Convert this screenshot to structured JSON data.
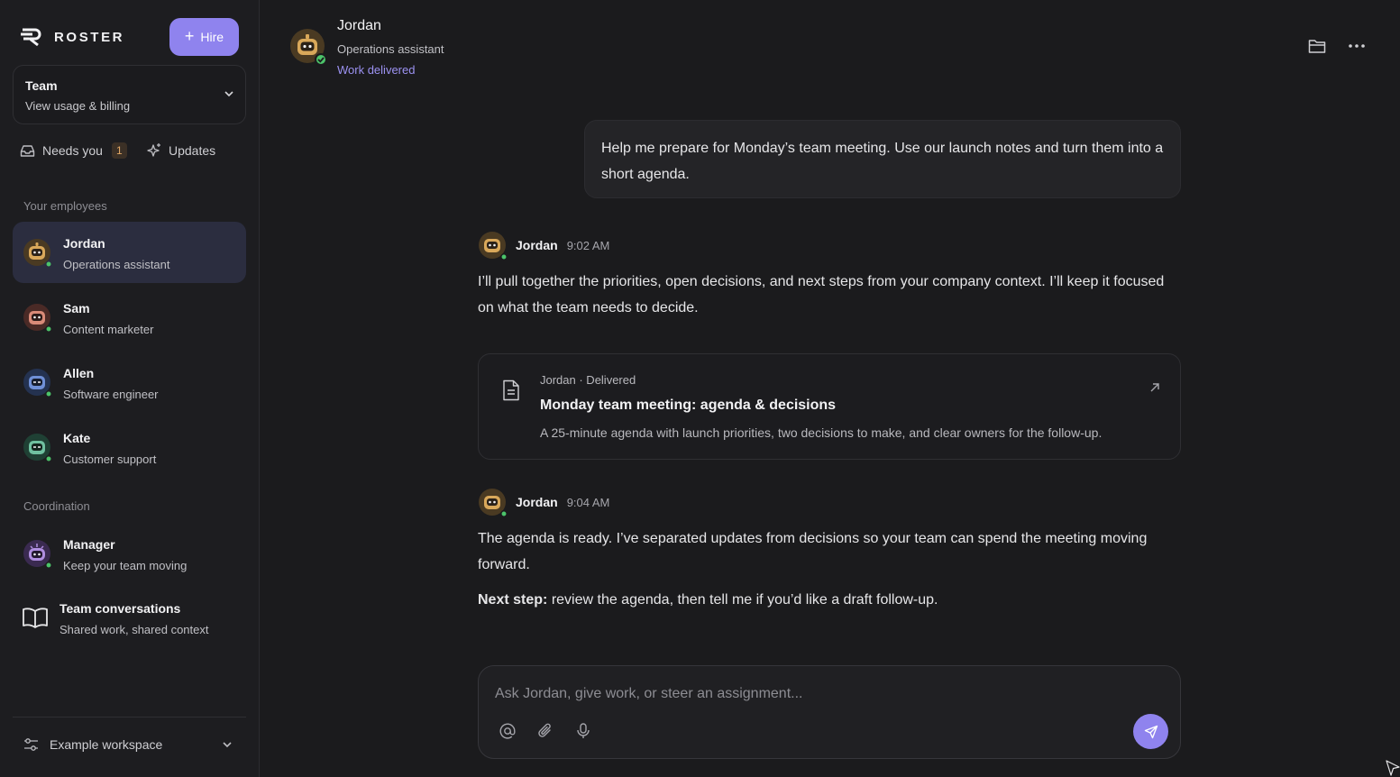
{
  "brand": {
    "name": "ROSTER"
  },
  "sidebar": {
    "hire_label": "Hire",
    "team": {
      "title": "Team",
      "subtitle": "View usage & billing"
    },
    "needs_you": {
      "label": "Needs you",
      "count": "1"
    },
    "updates_label": "Updates",
    "employees_heading": "Your employees",
    "employees": [
      {
        "name": "Jordan",
        "role": "Operations assistant",
        "color": "#d9a85a",
        "active": true
      },
      {
        "name": "Sam",
        "role": "Content marketer",
        "color": "#d98a78",
        "active": false
      },
      {
        "name": "Allen",
        "role": "Software engineer",
        "color": "#6f8fd6",
        "active": false
      },
      {
        "name": "Kate",
        "role": "Customer support",
        "color": "#6fc0a0",
        "active": false
      }
    ],
    "coordination_heading": "Coordination",
    "manager": {
      "name": "Manager",
      "role": "Keep your team moving",
      "color": "#b08ee0"
    },
    "conversations": {
      "title": "Team conversations",
      "subtitle": "Shared work, shared context"
    },
    "workspace_label": "Example workspace"
  },
  "header": {
    "name": "Jordan",
    "role": "Operations assistant",
    "status": "Work delivered"
  },
  "chat": {
    "user_message": "Help me prepare for Monday’s team meeting. Use our launch notes and turn them into a short agenda.",
    "messages": [
      {
        "name": "Jordan",
        "time": "9:02 AM",
        "text": "I’ll pull together the priorities, open decisions, and next steps from your company context. I’ll keep it focused on what the team needs to decide."
      },
      {
        "name": "Jordan",
        "time": "9:04 AM",
        "text": "The agenda is ready. I’ve separated updates from decisions so your team can spend the meeting moving forward.",
        "next_step_label": "Next step:",
        "next_step_text": "review the agenda, then tell me if you’d like a draft follow-up."
      }
    ],
    "deliverable": {
      "meta": "Jordan · Delivered",
      "title": "Monday team meeting: agenda & decisions",
      "description": "A 25-minute agenda with launch priorities, two decisions to make, and clear owners for the follow-up."
    }
  },
  "composer": {
    "placeholder": "Ask Jordan, give work, or steer an assignment..."
  },
  "colors": {
    "accent": "#8f83ee",
    "online": "#4cc46a",
    "background": "#1b1b1d"
  }
}
